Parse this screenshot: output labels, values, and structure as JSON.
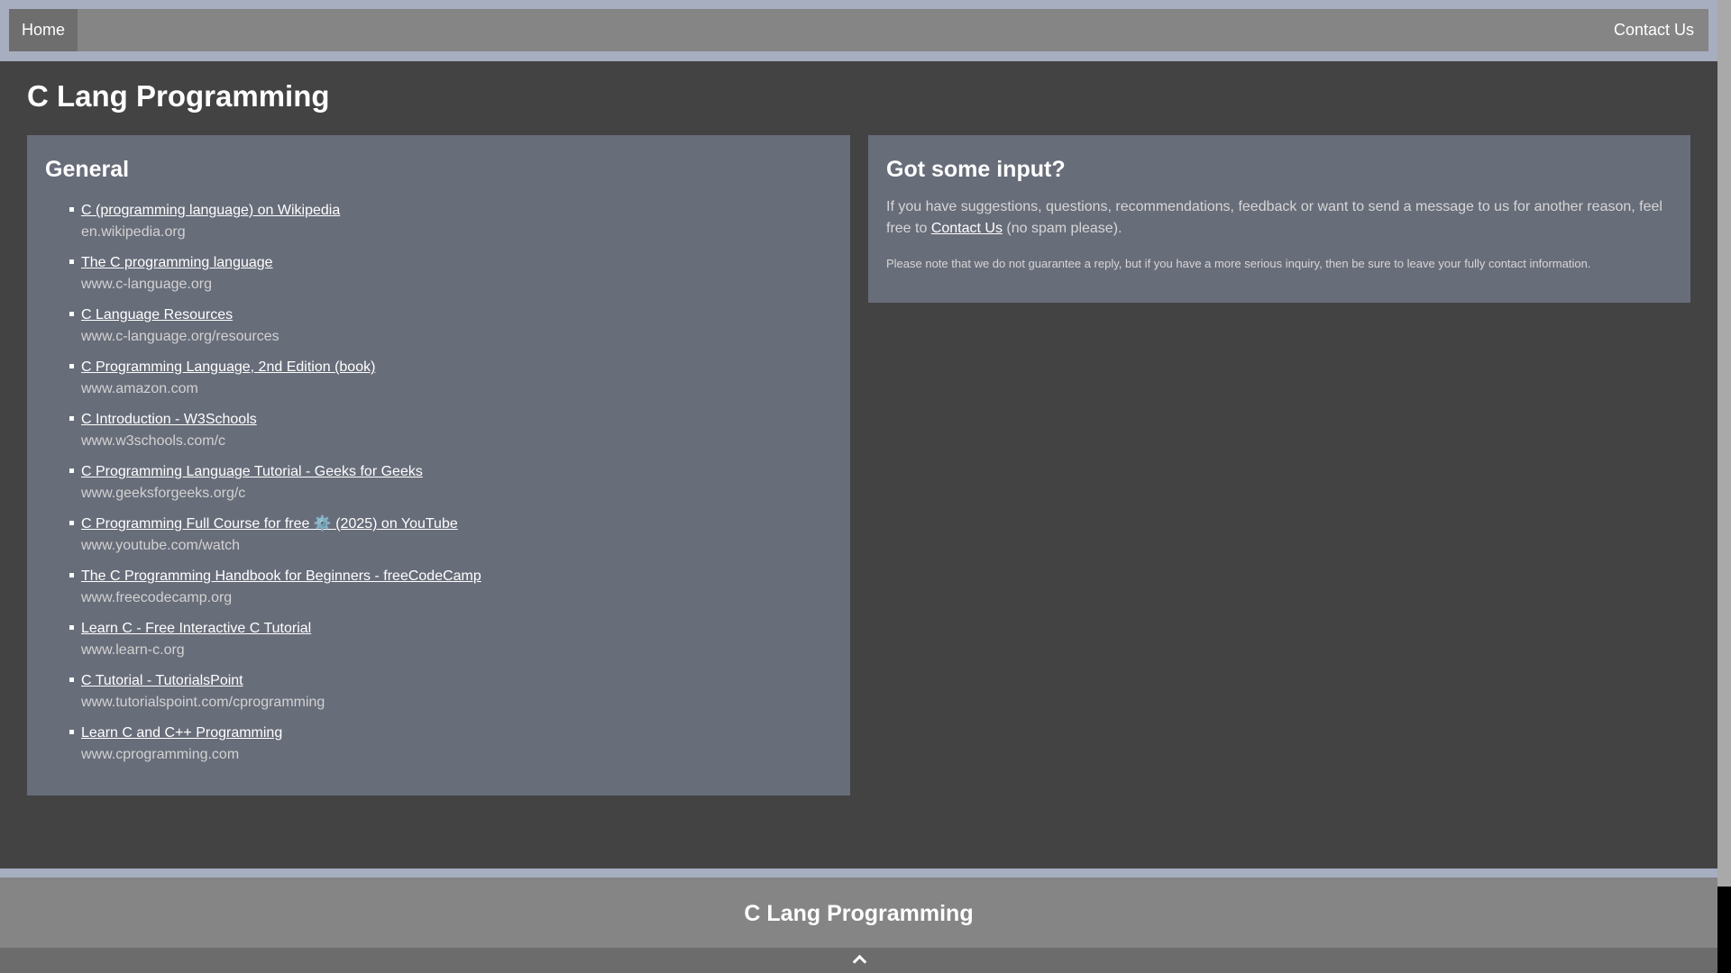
{
  "nav": {
    "home": "Home",
    "contact": "Contact Us"
  },
  "site_title": "C Lang Programming",
  "general": {
    "heading": "General",
    "links": [
      {
        "title": "C (programming language) on Wikipedia",
        "domain": "en.wikipedia.org"
      },
      {
        "title": "The C programming language",
        "domain": "www.c-language.org"
      },
      {
        "title": "C Language Resources",
        "domain": "www.c-language.org/resources"
      },
      {
        "title": "C Programming Language, 2nd Edition (book)",
        "domain": "www.amazon.com"
      },
      {
        "title": "C Introduction - W3Schools",
        "domain": "www.w3schools.com/c"
      },
      {
        "title": "C Programming Language Tutorial - Geeks for Geeks",
        "domain": "www.geeksforgeeks.org/c"
      },
      {
        "title": "C Programming Full Course for free ⚙️ (2025) on YouTube",
        "domain": "www.youtube.com/watch"
      },
      {
        "title": "The C Programming Handbook for Beginners - freeCodeCamp",
        "domain": "www.freecodecamp.org"
      },
      {
        "title": "Learn C - Free Interactive C Tutorial",
        "domain": "www.learn-c.org"
      },
      {
        "title": "C Tutorial - TutorialsPoint",
        "domain": "www.tutorialspoint.com/cprogramming"
      },
      {
        "title": "Learn C and C++ Programming",
        "domain": "www.cprogramming.com"
      }
    ]
  },
  "input": {
    "heading": "Got some input?",
    "text_before": "If you have suggestions, questions, recommendations, feedback or want to send a message to us for another reason, feel free to ",
    "contact_link": "Contact Us",
    "text_after": " (no spam please).",
    "note": "Please note that we do not guarantee a reply, but if you have a more serious inquiry, then be sure to leave your fully contact information."
  },
  "footer": {
    "title": "C Lang Programming"
  },
  "back_to_top_icon": "chevron-up-icon"
}
